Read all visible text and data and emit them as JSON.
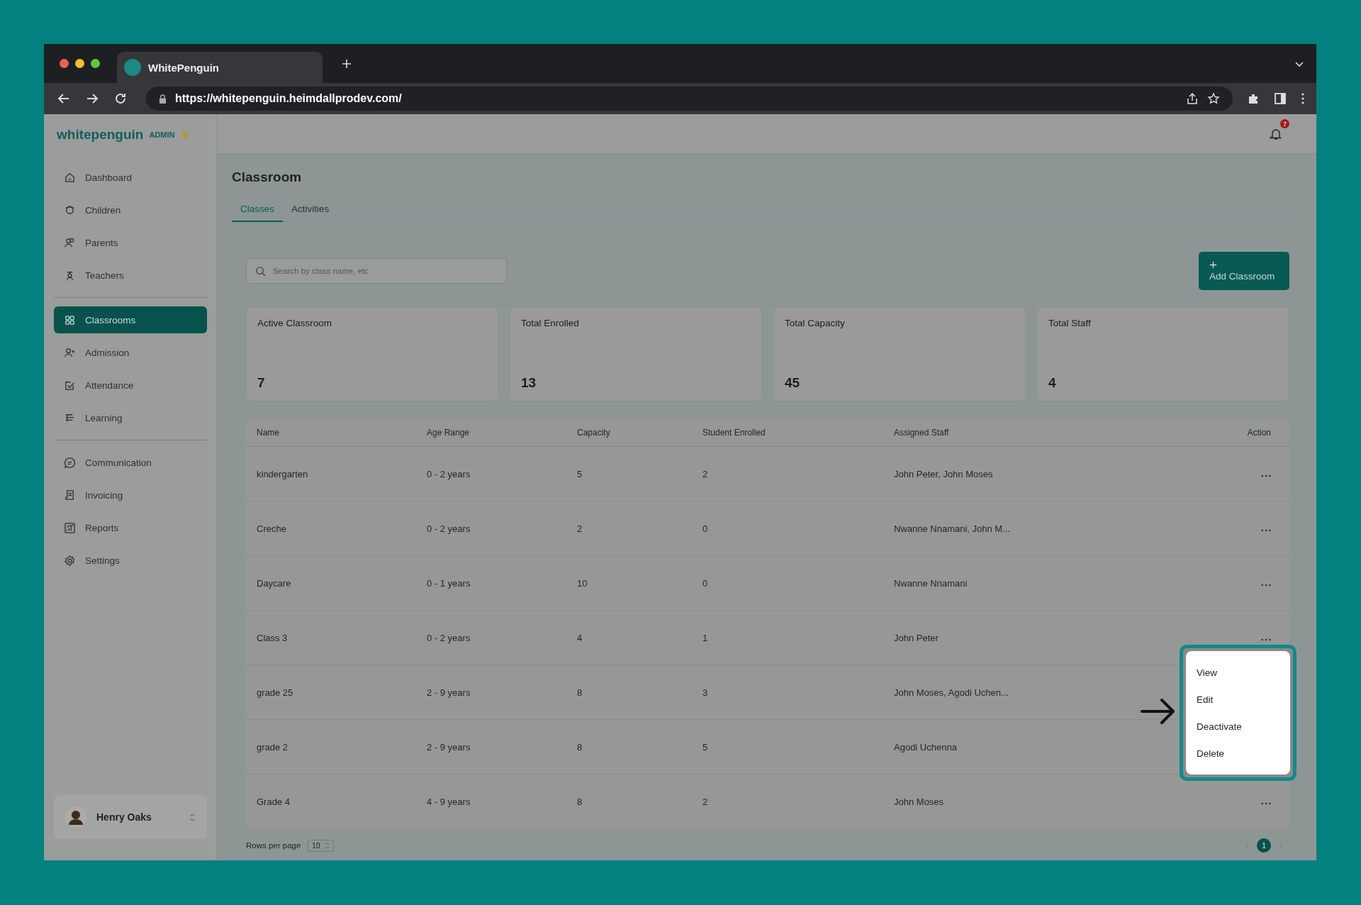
{
  "browser": {
    "tab_title": "WhitePenguin",
    "url": "https://whitepenguin.heimdallprodev.com/"
  },
  "sidebar": {
    "logo": "whitepenguin",
    "role": "ADMIN",
    "groups": [
      [
        {
          "label": "Dashboard",
          "selected": false
        },
        {
          "label": "Children",
          "selected": false
        },
        {
          "label": "Parents",
          "selected": false
        },
        {
          "label": "Teachers",
          "selected": false
        }
      ],
      [
        {
          "label": "Classrooms",
          "selected": true
        },
        {
          "label": "Admission",
          "selected": false
        },
        {
          "label": "Attendance",
          "selected": false
        },
        {
          "label": "Learning",
          "selected": false
        }
      ],
      [
        {
          "label": "Communication",
          "selected": false
        },
        {
          "label": "Invoicing",
          "selected": false
        },
        {
          "label": "Reports",
          "selected": false
        },
        {
          "label": "Settings",
          "selected": false
        }
      ]
    ],
    "user": {
      "name": "Henry Oaks"
    }
  },
  "topbar": {
    "notification_count": "7"
  },
  "page": {
    "title": "Classroom",
    "tabs": [
      {
        "label": "Classes",
        "selected": true
      },
      {
        "label": "Activities",
        "selected": false
      }
    ],
    "search": {
      "placeholder": "Search by class name, etc"
    },
    "add_button": "Add Classroom",
    "stats": [
      {
        "label": "Active Classroom",
        "value": "7"
      },
      {
        "label": "Total Enrolled",
        "value": "13"
      },
      {
        "label": "Total Capacity",
        "value": "45"
      },
      {
        "label": "Total Staff",
        "value": "4"
      }
    ],
    "table": {
      "columns": [
        "Name",
        "Age Range",
        "Capacity",
        "Student Enrolled",
        "Assigned Staff",
        "Action"
      ],
      "rows": [
        [
          "kindergarten",
          "0 - 2 years",
          "5",
          "2",
          "John Peter, John Moses"
        ],
        [
          "Creche",
          "0 - 2 years",
          "2",
          "0",
          "Nwanne Nnamani, John M..."
        ],
        [
          "Daycare",
          "0 - 1 years",
          "10",
          "0",
          "Nwanne Nnamani"
        ],
        [
          "Class 3",
          "0 - 2 years",
          "4",
          "1",
          "John Peter"
        ],
        [
          "grade 25",
          "2 - 9 years",
          "8",
          "3",
          "John Moses, Agodi Uchen..."
        ],
        [
          "grade 2",
          "2 - 9 years",
          "8",
          "5",
          "Agodi Uchenna"
        ],
        [
          "Grade 4",
          "4 - 9 years",
          "8",
          "2",
          "John Moses"
        ]
      ]
    },
    "context_menu": [
      "View",
      "Edit",
      "Deactivate",
      "Delete"
    ],
    "pagination": {
      "rows_per_page_label": "Rows per page",
      "rows_per_page": "10",
      "pages": [
        {
          "label": "1",
          "selected": true
        }
      ]
    }
  }
}
